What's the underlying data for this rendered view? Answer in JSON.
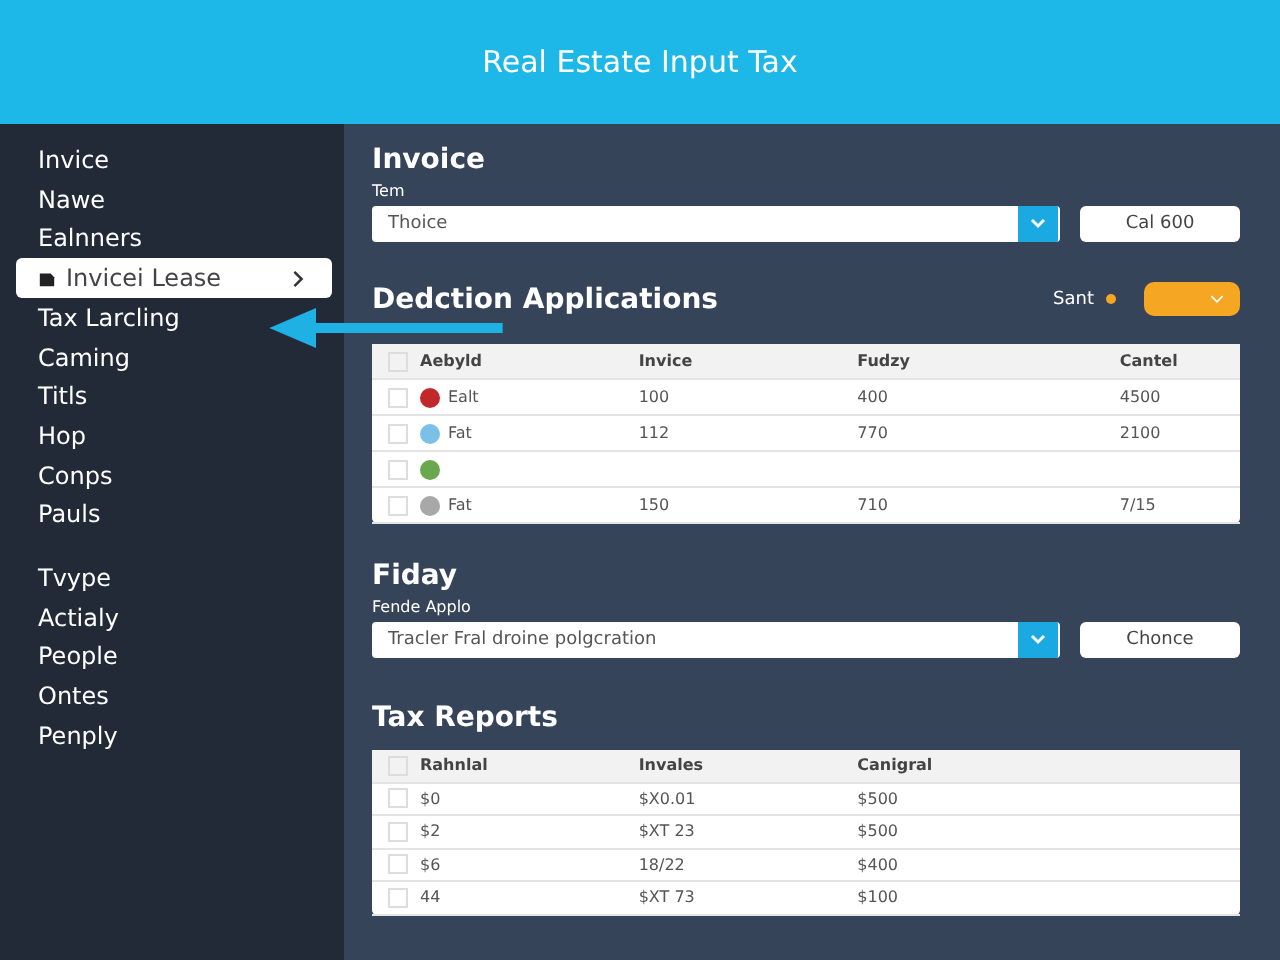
{
  "header": {
    "title": "Real Estate Input Tax"
  },
  "sidebar": {
    "groups": [
      {
        "items": [
          {
            "label": "Invice",
            "selected": false
          },
          {
            "label": "Nawe",
            "selected": false
          },
          {
            "label": "Ealnners",
            "selected": false
          },
          {
            "label": "Invicei Lease",
            "selected": true
          },
          {
            "label": "Tax Larcling",
            "selected": false
          },
          {
            "label": "Caming",
            "selected": false
          },
          {
            "label": "Titls",
            "selected": false
          },
          {
            "label": "Hop",
            "selected": false
          },
          {
            "label": "Conps",
            "selected": false
          },
          {
            "label": "Pauls",
            "selected": false
          }
        ]
      },
      {
        "items": [
          {
            "label": "Tvype",
            "selected": false
          },
          {
            "label": "Actialy",
            "selected": false
          },
          {
            "label": "People",
            "selected": false
          },
          {
            "label": "Ontes",
            "selected": false
          },
          {
            "label": "Penply",
            "selected": false
          }
        ]
      }
    ]
  },
  "invoice": {
    "title": "Invoice",
    "field_label": "Tem",
    "select_value": "Thoice",
    "button": "Cal 600"
  },
  "deductions": {
    "title": "Dedction Applications",
    "sort_label": "Sant",
    "all_checked": false,
    "columns": [
      "Aebyld",
      "Invice",
      "Fudzy",
      "Cantel"
    ],
    "rows": [
      {
        "checked": false,
        "color": "#c0282c",
        "cells": [
          "Ealt",
          "100",
          "400",
          "4500"
        ]
      },
      {
        "checked": false,
        "color": "#7cc0e8",
        "cells": [
          "Fat",
          "112",
          "770",
          "2100"
        ]
      },
      {
        "checked": false,
        "color": "#6aa84f",
        "cells": []
      },
      {
        "checked": false,
        "color": "#a8a8a8",
        "cells": [
          "Fat",
          "150",
          "710",
          "7/15"
        ]
      }
    ]
  },
  "fiday": {
    "title": "Fiday",
    "field_label": "Fende Applo",
    "select_value": "Tracler Fral droine polgcration",
    "button": "Chonce"
  },
  "tax_reports": {
    "title": "Tax Reports",
    "all_checked": false,
    "columns": [
      "Rahnlal",
      "Invales",
      "Canigral"
    ],
    "rows": [
      {
        "checked": false,
        "cells": [
          "$0",
          "$X0.01",
          "$500"
        ]
      },
      {
        "checked": false,
        "cells": [
          "$2",
          "$XT 23",
          "$500"
        ]
      },
      {
        "checked": false,
        "cells": [
          "$6",
          "18/22",
          "$400"
        ]
      },
      {
        "checked": false,
        "cells": [
          "44",
          "$XT 73",
          "$100"
        ]
      }
    ]
  }
}
